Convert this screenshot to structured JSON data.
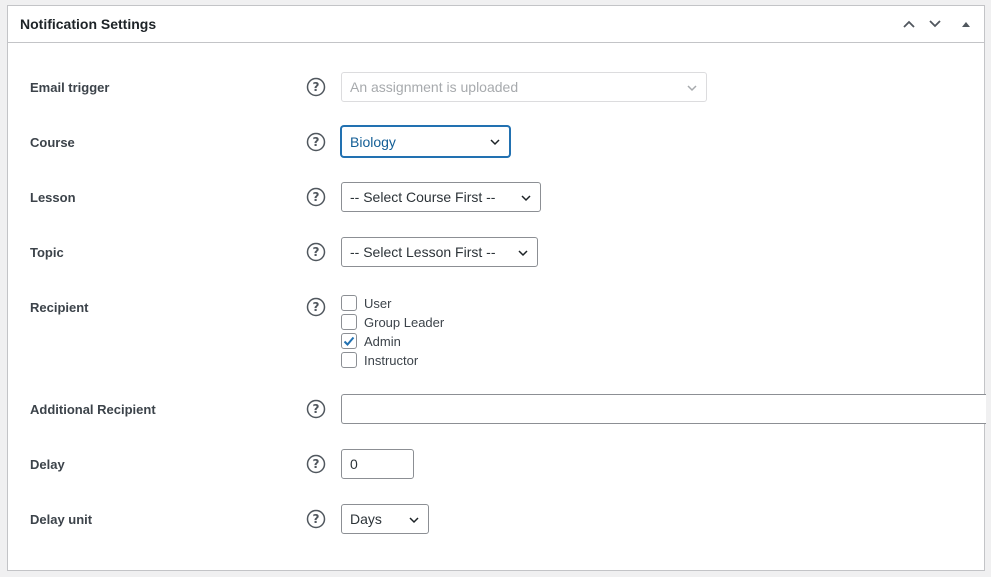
{
  "panel": {
    "title": "Notification Settings",
    "controls": {
      "move_up": "chevron-up-icon",
      "move_down": "chevron-down-icon",
      "toggle": "caret-up-icon"
    }
  },
  "fields": {
    "email_trigger": {
      "label": "Email trigger",
      "value": "An assignment is uploaded",
      "disabled": true
    },
    "course": {
      "label": "Course",
      "value": "Biology"
    },
    "lesson": {
      "label": "Lesson",
      "value": "-- Select Course First --"
    },
    "topic": {
      "label": "Topic",
      "value": "-- Select Lesson First --"
    },
    "recipient": {
      "label": "Recipient",
      "options": [
        {
          "label": "User",
          "checked": false
        },
        {
          "label": "Group Leader",
          "checked": false
        },
        {
          "label": "Admin",
          "checked": true
        },
        {
          "label": "Instructor",
          "checked": false
        }
      ]
    },
    "additional_recipient": {
      "label": "Additional Recipient",
      "value": ""
    },
    "delay": {
      "label": "Delay",
      "value": "0"
    },
    "delay_unit": {
      "label": "Delay unit",
      "value": "Days"
    }
  },
  "colors": {
    "accent": "#2271b1",
    "border": "#c3c4c7",
    "background": "#f0f0f1"
  }
}
